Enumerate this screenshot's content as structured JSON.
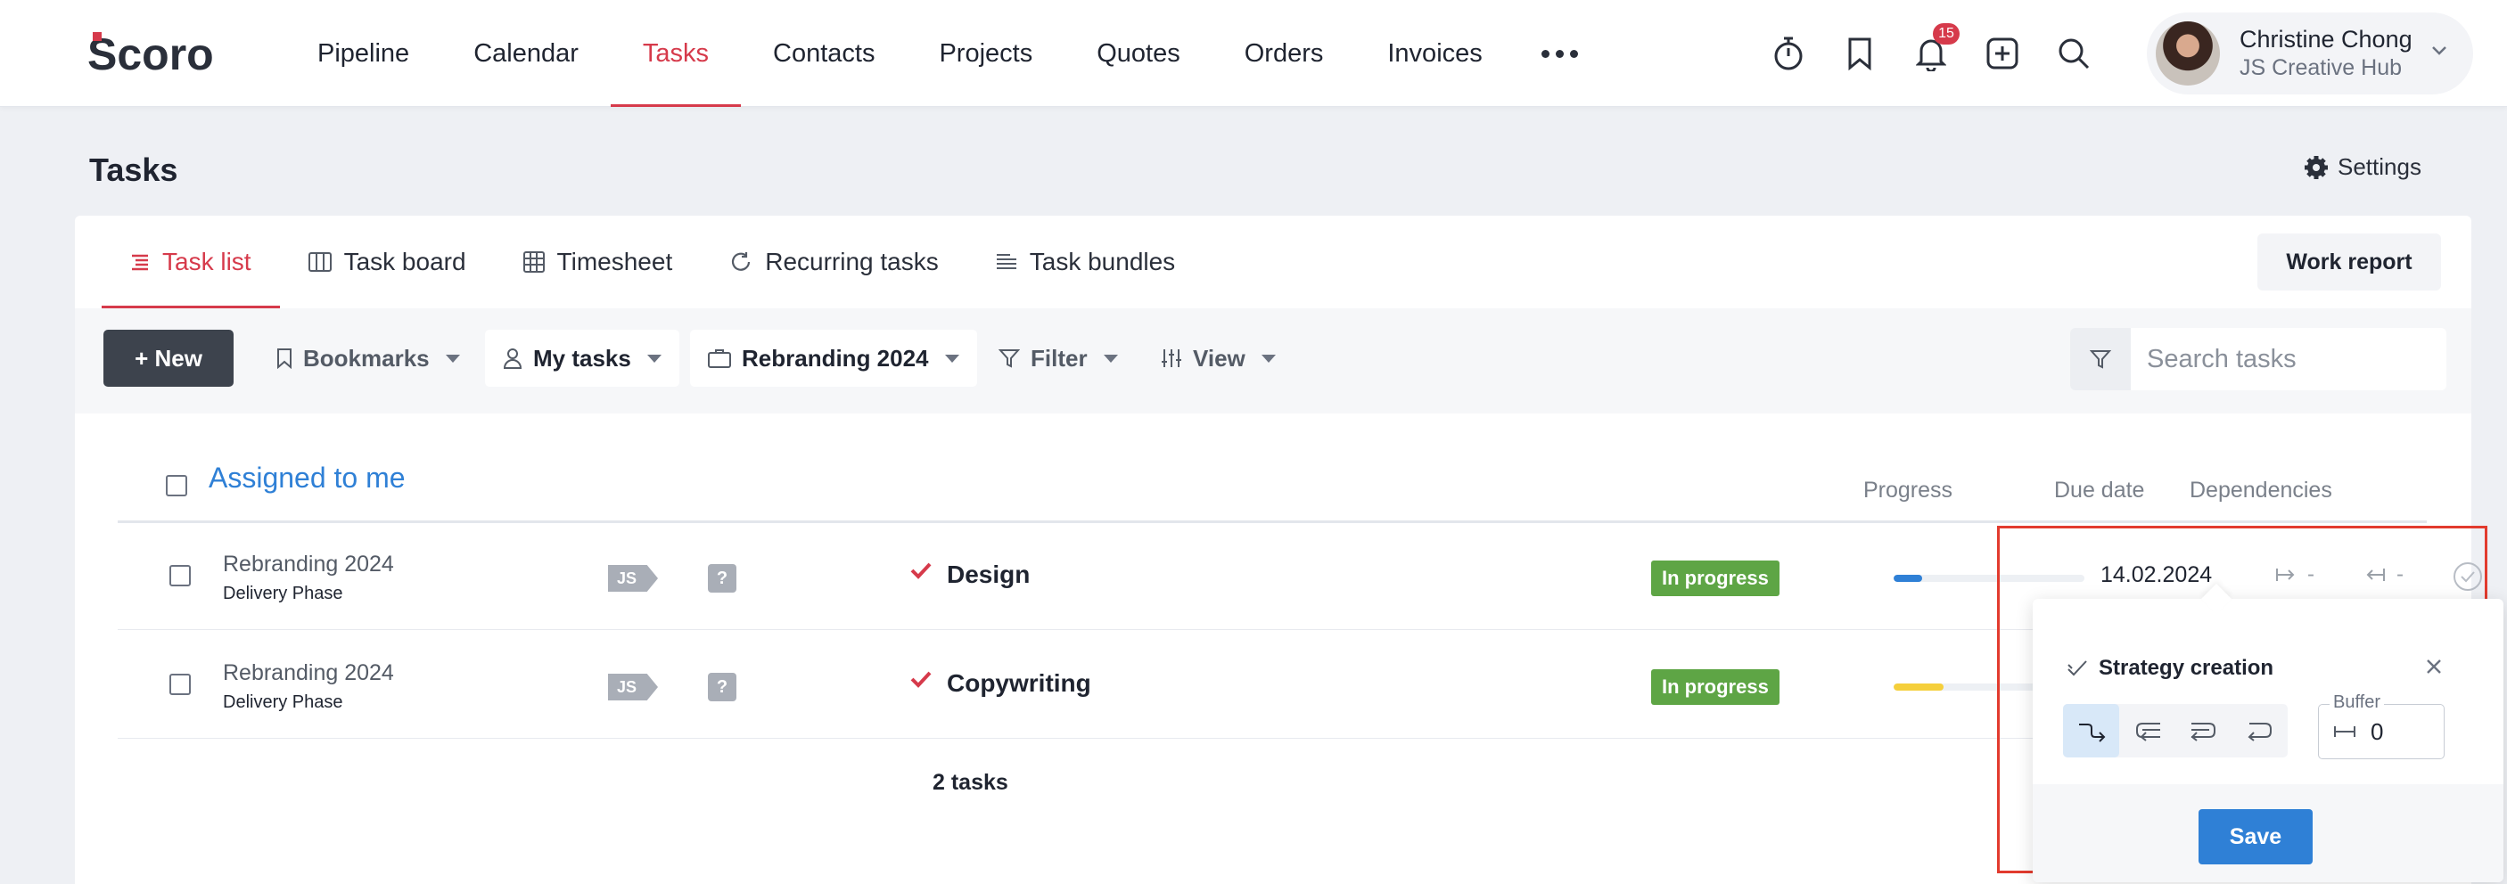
{
  "brand": {
    "logo_text": "Scoro",
    "accent": "#d63a4b"
  },
  "nav": {
    "items": [
      {
        "label": "Pipeline"
      },
      {
        "label": "Calendar"
      },
      {
        "label": "Tasks",
        "active": true
      },
      {
        "label": "Contacts"
      },
      {
        "label": "Projects"
      },
      {
        "label": "Quotes"
      },
      {
        "label": "Orders"
      },
      {
        "label": "Invoices"
      }
    ],
    "more_icon": "more-horizontal-icon",
    "notifications_count": "15",
    "user_name": "Christine Chong",
    "user_org": "JS Creative Hub"
  },
  "page": {
    "title": "Tasks",
    "settings_label": "Settings"
  },
  "tabs": [
    {
      "label": "Task list",
      "icon": "list-icon",
      "active": true
    },
    {
      "label": "Task board",
      "icon": "board-icon"
    },
    {
      "label": "Timesheet",
      "icon": "grid-icon"
    },
    {
      "label": "Recurring tasks",
      "icon": "refresh-icon"
    },
    {
      "label": "Task bundles",
      "icon": "bundle-icon"
    }
  ],
  "work_report_label": "Work report",
  "toolbar": {
    "new_label": "+ New",
    "bookmarks_label": "Bookmarks",
    "my_tasks_label": "My tasks",
    "project_label": "Rebranding 2024",
    "filter_label": "Filter",
    "view_label": "View",
    "search_placeholder": "Search tasks"
  },
  "group": {
    "title": "Assigned to me",
    "col_progress": "Progress",
    "col_due": "Due date",
    "col_dependencies": "Dependencies"
  },
  "rows": [
    {
      "project": "Rebranding 2024",
      "phase": "Delivery Phase",
      "assignee": "JS",
      "unknown": "?",
      "task": "Design",
      "status": "In progress",
      "progress": 0.15,
      "progress_color": "#2f80d6",
      "due": "14.02.2024",
      "dep_in": "-",
      "dep_out": "-"
    },
    {
      "project": "Rebranding 2024",
      "phase": "Delivery Phase",
      "assignee": "JS",
      "unknown": "?",
      "task": "Copywriting",
      "status": "In progress",
      "progress": 0.26,
      "progress_color": "#f5cf3b"
    }
  ],
  "footer": {
    "count_label": "2 tasks"
  },
  "popover": {
    "title": "Strategy creation",
    "buffer_label": "Buffer",
    "buffer_value": "0",
    "save_label": "Save",
    "dependency_types": [
      "finish-to-start-icon",
      "start-to-start-icon",
      "finish-to-finish-icon",
      "start-to-finish-icon"
    ]
  }
}
